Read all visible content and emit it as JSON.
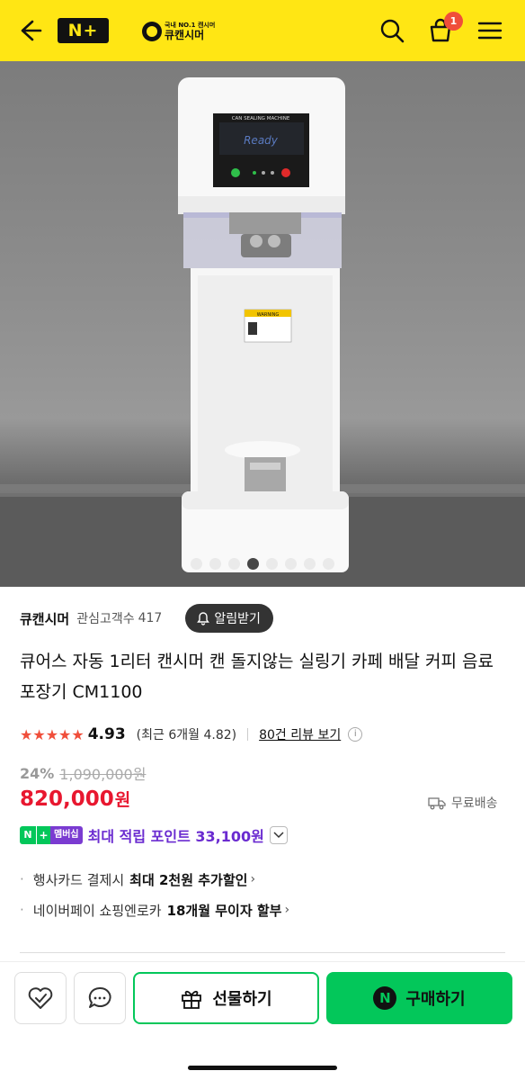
{
  "header": {
    "logo_text": "N+",
    "brand_sub": "국내 NO.1 캔시머",
    "brand_main": "큐캔시머",
    "cart_count": "1",
    "icons": [
      "back-arrow-icon",
      "search-icon",
      "cart-icon",
      "menu-icon"
    ]
  },
  "hero": {
    "screen_title": "CAN SEALING MACHINE",
    "screen_status": "Ready",
    "warning_label": "WARNING",
    "image_count": 8,
    "active_index": 3
  },
  "seller": {
    "name": "큐캔시머",
    "follower_label": "관심고객수",
    "follower_count": "417",
    "alert_label": "알림받기"
  },
  "product": {
    "title": "큐어스 자동 1리터 캔시머 캔 돌지않는 실링기 카페 배달 커피 음료 포장기 CM1100"
  },
  "rating": {
    "stars": "★★★★★",
    "score": "4.93",
    "recent": "(최근 6개월 4.82)",
    "reviews_link": "80건 리뷰 보기",
    "info": "i"
  },
  "price": {
    "discount_rate": "24%",
    "original": "1,090,000원",
    "value": "820,000",
    "unit": "원",
    "shipping": "무료배송"
  },
  "points": {
    "badge_n": "N",
    "badge_plus": "+",
    "badge_member": "멤버십",
    "text": "최대 적립 포인트 33,100원"
  },
  "benefits": [
    {
      "prefix": "행사카드 결제시",
      "bold": "최대 2천원 추가할인"
    },
    {
      "prefix": "네이버페이 쇼핑엔로카",
      "bold": "18개월 무이자 할부"
    }
  ],
  "bottom": {
    "gift_label": "선물하기",
    "buy_label": "구매하기",
    "npay_symbol": "N"
  },
  "colors": {
    "header_bg": "#ffe614",
    "price_red": "#e8172f",
    "star_red": "#f04e3a",
    "naver_green": "#03c75a",
    "points_purple": "#6a2bd0"
  }
}
